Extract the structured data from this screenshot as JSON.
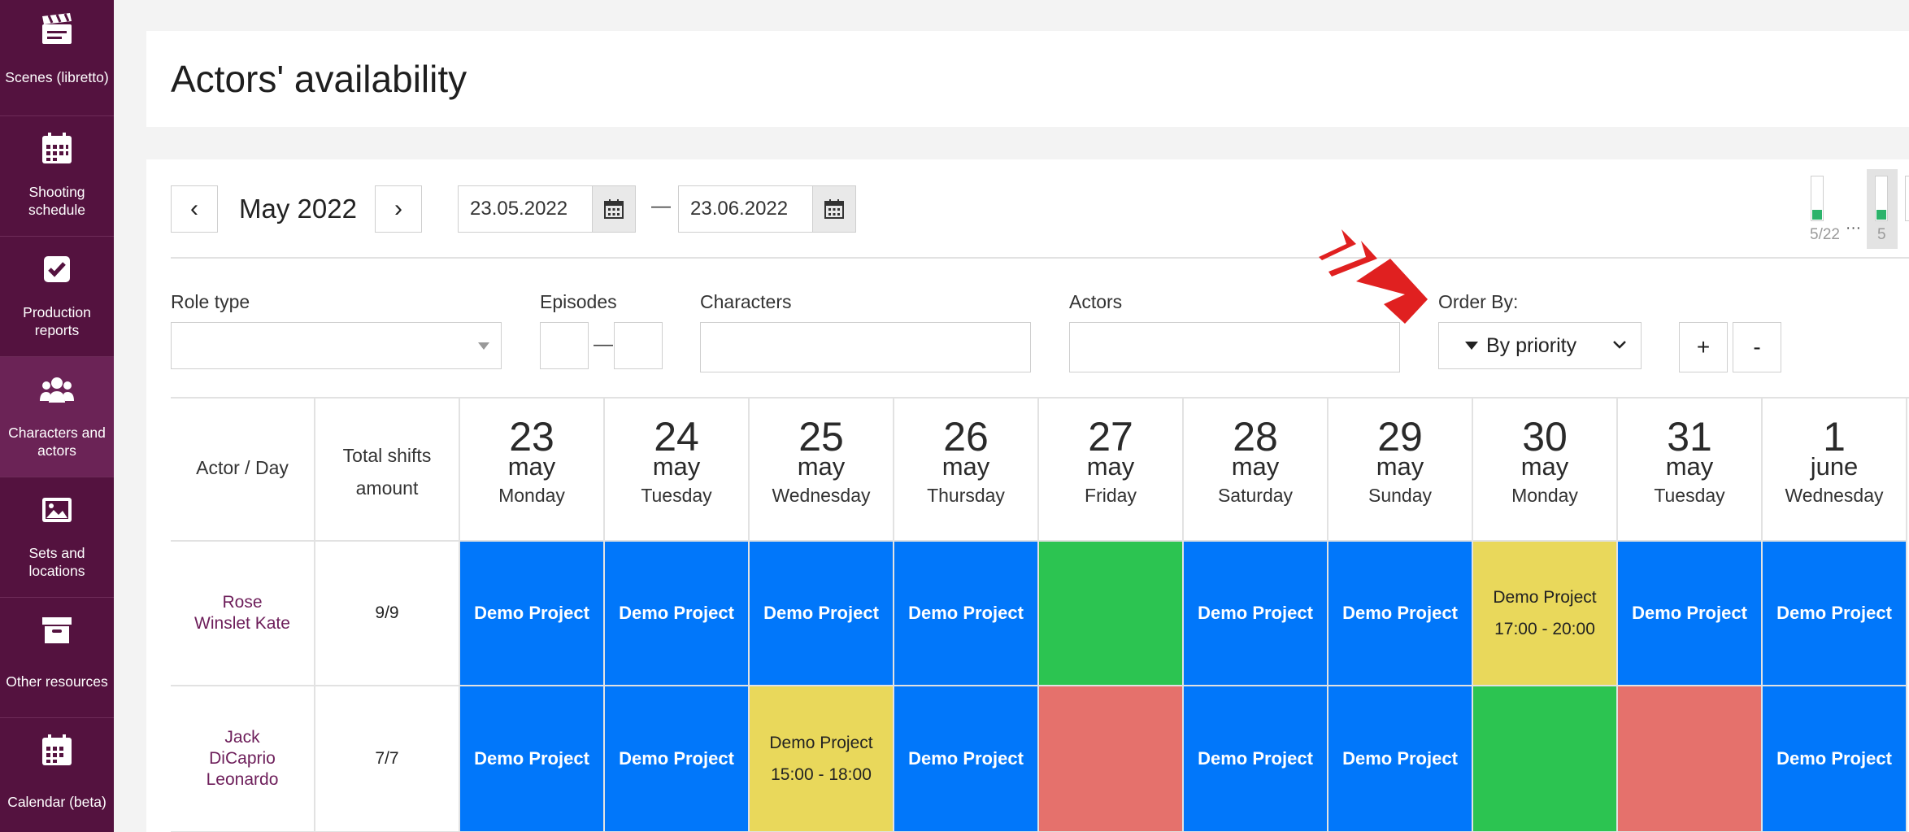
{
  "sidebar": {
    "items": [
      {
        "label": "Scenes (libretto)",
        "icon": "clapperboard-icon"
      },
      {
        "label": "Shooting schedule",
        "icon": "calendar-grid-icon"
      },
      {
        "label": "Production reports",
        "icon": "checkbox-icon"
      },
      {
        "label": "Characters and actors",
        "icon": "people-group-icon"
      },
      {
        "label": "Sets and locations",
        "icon": "image-icon"
      },
      {
        "label": "Other resources",
        "icon": "archive-box-icon"
      },
      {
        "label": "Calendar (beta)",
        "icon": "calendar-icon"
      }
    ]
  },
  "page": {
    "title": "Actors' availability"
  },
  "period": {
    "prev": "‹",
    "next": "›",
    "month": "May 2022",
    "from": "23.05.2022",
    "to": "23.06.2022",
    "separator": "—"
  },
  "progress": {
    "label": "5/22",
    "more": "···",
    "current": "5",
    "fraction": 0.23
  },
  "filters": {
    "role_type": {
      "label": "Role type",
      "value": ""
    },
    "episodes": {
      "label": "Episodes",
      "from": "",
      "to": "",
      "separator": "—"
    },
    "characters": {
      "label": "Characters",
      "value": ""
    },
    "actors": {
      "label": "Actors",
      "value": ""
    },
    "order_by": {
      "label": "Order By:",
      "value": "By priority"
    },
    "zoom_in": "+",
    "zoom_out": "-"
  },
  "table": {
    "col_actor": "Actor / Day",
    "col_total": "Total shifts amount",
    "days": [
      {
        "num": "23",
        "month": "may",
        "weekday": "Monday"
      },
      {
        "num": "24",
        "month": "may",
        "weekday": "Tuesday"
      },
      {
        "num": "25",
        "month": "may",
        "weekday": "Wednesday"
      },
      {
        "num": "26",
        "month": "may",
        "weekday": "Thursday"
      },
      {
        "num": "27",
        "month": "may",
        "weekday": "Friday"
      },
      {
        "num": "28",
        "month": "may",
        "weekday": "Saturday"
      },
      {
        "num": "29",
        "month": "may",
        "weekday": "Sunday"
      },
      {
        "num": "30",
        "month": "may",
        "weekday": "Monday"
      },
      {
        "num": "31",
        "month": "may",
        "weekday": "Tuesday"
      },
      {
        "num": "1",
        "month": "june",
        "weekday": "Wednesday"
      }
    ],
    "rows": [
      {
        "actor": [
          "Rose",
          "Winslet Kate"
        ],
        "total": "9/9",
        "cells": [
          {
            "status": "blue",
            "project": "Demo Project",
            "time": ""
          },
          {
            "status": "blue",
            "project": "Demo Project",
            "time": ""
          },
          {
            "status": "blue",
            "project": "Demo Project",
            "time": ""
          },
          {
            "status": "blue",
            "project": "Demo Project",
            "time": ""
          },
          {
            "status": "green",
            "project": "",
            "time": ""
          },
          {
            "status": "blue",
            "project": "Demo Project",
            "time": ""
          },
          {
            "status": "blue",
            "project": "Demo Project",
            "time": ""
          },
          {
            "status": "yellow",
            "project": "Demo Project",
            "time": "17:00 - 20:00"
          },
          {
            "status": "blue",
            "project": "Demo Project",
            "time": ""
          },
          {
            "status": "blue",
            "project": "Demo Project",
            "time": ""
          }
        ]
      },
      {
        "actor": [
          "Jaсk",
          "DiCaprio",
          "Leonardo"
        ],
        "total": "7/7",
        "cells": [
          {
            "status": "blue",
            "project": "Demo Project",
            "time": ""
          },
          {
            "status": "blue",
            "project": "Demo Project",
            "time": ""
          },
          {
            "status": "yellow",
            "project": "Demo Project",
            "time": "15:00 - 18:00"
          },
          {
            "status": "blue",
            "project": "Demo Project",
            "time": ""
          },
          {
            "status": "red",
            "project": "",
            "time": ""
          },
          {
            "status": "blue",
            "project": "Demo Project",
            "time": ""
          },
          {
            "status": "blue",
            "project": "Demo Project",
            "time": ""
          },
          {
            "status": "green",
            "project": "",
            "time": ""
          },
          {
            "status": "red",
            "project": "",
            "time": ""
          },
          {
            "status": "blue",
            "project": "Demo Project",
            "time": ""
          }
        ]
      }
    ]
  },
  "colors": {
    "sidebar": "#54123f",
    "blue": "#0177fa",
    "green": "#2cc451",
    "red": "#e5716c",
    "yellow": "#e9d85b",
    "accent_arrow": "#e02020"
  }
}
